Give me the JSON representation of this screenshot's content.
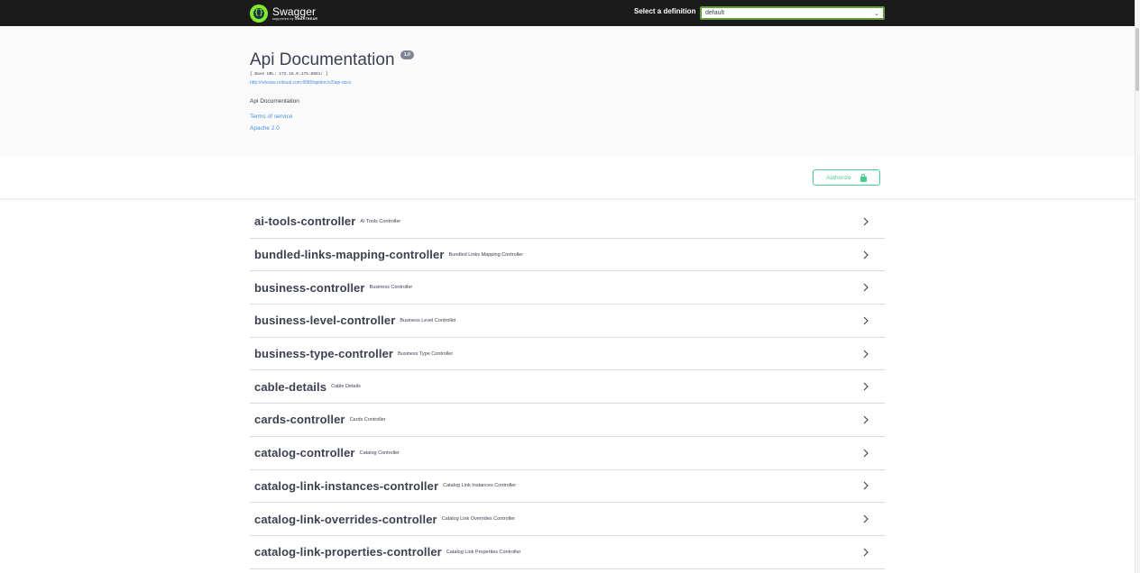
{
  "header": {
    "brand_name": "Swagger",
    "brand_sub_prefix": "supported by ",
    "brand_sub_strong": "SMARTBEAR",
    "definition_label": "Select a definition",
    "definition_selected": "default"
  },
  "info": {
    "title": "Api Documentation",
    "version": "1.0",
    "base_url": "[ Base URL: 172.18.0.175:8081/ ]",
    "api_docs_url": "http://release.rvitsual.com:8080/apidoc/v2/api-docs",
    "description": "Api Documentation",
    "terms_of_service": "Terms of service",
    "license": "Apache 2.0"
  },
  "scheme": {
    "authorize_label": "Authorize"
  },
  "tags": [
    {
      "name": "ai-tools-controller",
      "description": "AI Tools Controller"
    },
    {
      "name": "bundled-links-mapping-controller",
      "description": "Bundled Links Mapping Controller"
    },
    {
      "name": "business-controller",
      "description": "Business Controller"
    },
    {
      "name": "business-level-controller",
      "description": "Business Level Controller"
    },
    {
      "name": "business-type-controller",
      "description": "Business Type Controller"
    },
    {
      "name": "cable-details",
      "description": "Cable Details"
    },
    {
      "name": "cards-controller",
      "description": "Cards Controller"
    },
    {
      "name": "catalog-controller",
      "description": "Catalog Controller"
    },
    {
      "name": "catalog-link-instances-controller",
      "description": "Catalog Link Instances Controller"
    },
    {
      "name": "catalog-link-overrides-controller",
      "description": "Catalog Link Overrides Controller"
    },
    {
      "name": "catalog-link-properties-controller",
      "description": "Catalog Link Properties Controller"
    }
  ],
  "colors": {
    "topbar": "#1b1b1b",
    "logo": "#85ea2d",
    "select_border": "#62a03f",
    "link": "#4990e2",
    "authorize": "#49cc90",
    "text": "#3b4151"
  },
  "icons": {
    "logo": "swagger-logo-icon",
    "select_arrow": "chevron-down-icon",
    "authorize": "lock-icon",
    "tag_expand": "chevron-right-icon"
  }
}
